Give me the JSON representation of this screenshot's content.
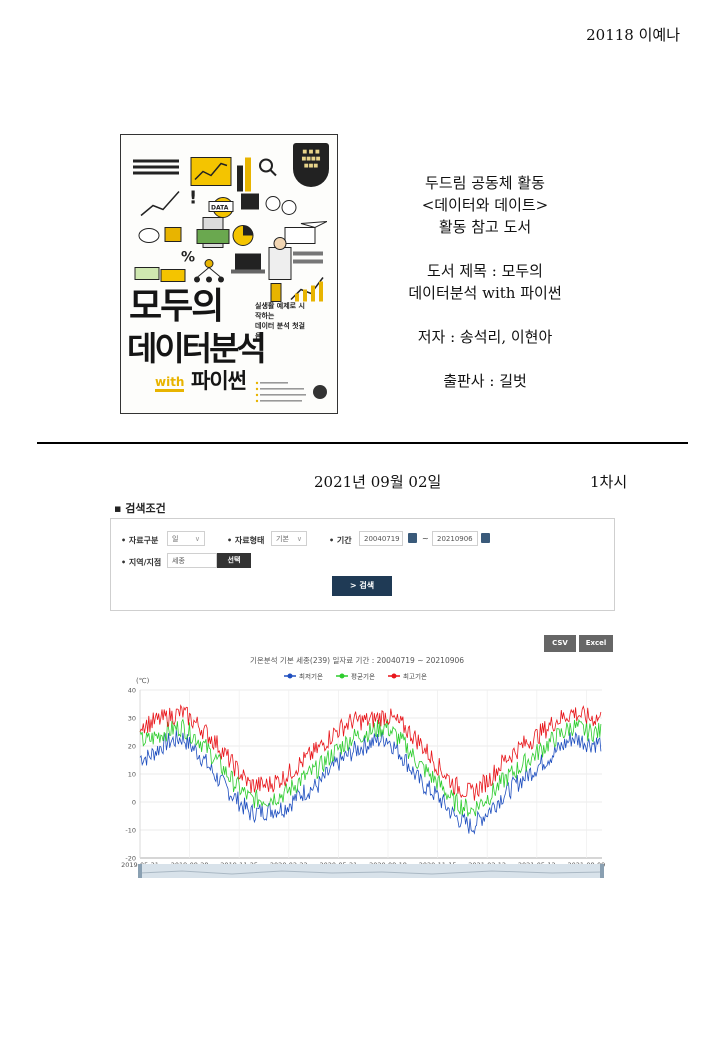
{
  "header": {
    "student": "20118 이예나"
  },
  "book_cover": {
    "title_line1": "모두의",
    "title_line2": "데이터분석",
    "with": "with",
    "python": "파이썬",
    "subtitle_line1": "실생활 예제로 시작하는",
    "subtitle_line2": "데이터 분석 첫걸음",
    "data_badge": "DATA"
  },
  "description": {
    "activity_line1": "두드림 공동체 활동",
    "activity_line2": "<데이터와 데이트>",
    "activity_line3": "활동 참고 도서",
    "book_title_line1": "도서 제목 : 모두의",
    "book_title_line2": "데이터분석 with 파이썬",
    "authors": "저자 : 송석리, 이현아",
    "publisher": "출판사 : 길벗"
  },
  "session": {
    "date": "2021년 09월 02일",
    "round": "1차시"
  },
  "search": {
    "section_title": "▪ 검색조건",
    "data_type_label": "• 자료구분",
    "data_type_value": "일",
    "data_form_label": "• 자료형태",
    "data_form_value": "기본",
    "period_label": "• 기간",
    "start_date": "20040719",
    "tilde": "~",
    "end_date": "20210906",
    "region_label": "• 지역/지점",
    "region_value": "세종",
    "select_button": "선택",
    "search_button": "> 검색"
  },
  "export": {
    "csv": "CSV",
    "excel": "Excel"
  },
  "chart_data": {
    "type": "line",
    "title": "기온분석 기본 세종(239) 일자료 기간 : 20040719 ~ 20210906",
    "ylabel": "(℃)",
    "ylim": [
      -20,
      40
    ],
    "yticks": [
      "40",
      "30",
      "20",
      "10",
      "0",
      "-10",
      "-20"
    ],
    "x_tick_labels": [
      "2019-05-31",
      "2019-08-28",
      "2019-11-25",
      "2020-02-22",
      "2020-05-21",
      "2020-08-18",
      "2020-11-15",
      "2021-02-12",
      "2021-05-12",
      "2021-08-09"
    ],
    "x_range": [
      "2019-05-31",
      "2021-09-06"
    ],
    "grid": true,
    "legend_position": "top-center",
    "series": [
      {
        "name": "최저기온",
        "color": "#1f4fbf",
        "monthly_x": [
          "2019-06",
          "2019-07",
          "2019-08",
          "2019-09",
          "2019-10",
          "2019-11",
          "2019-12",
          "2020-01",
          "2020-02",
          "2020-03",
          "2020-04",
          "2020-05",
          "2020-06",
          "2020-07",
          "2020-08",
          "2020-09",
          "2020-10",
          "2020-11",
          "2020-12",
          "2021-01",
          "2021-02",
          "2021-03",
          "2021-04",
          "2021-05",
          "2021-06",
          "2021-07",
          "2021-08"
        ],
        "values": [
          16,
          21,
          23,
          17,
          9,
          2,
          -4,
          -3,
          -2,
          3,
          6,
          13,
          18,
          21,
          23,
          16,
          7,
          2,
          -5,
          -9,
          -3,
          3,
          8,
          13,
          18,
          23,
          21
        ]
      },
      {
        "name": "평균기온",
        "color": "#2ecc2e",
        "monthly_x": [
          "2019-06",
          "2019-07",
          "2019-08",
          "2019-09",
          "2019-10",
          "2019-11",
          "2019-12",
          "2020-01",
          "2020-02",
          "2020-03",
          "2020-04",
          "2020-05",
          "2020-06",
          "2020-07",
          "2020-08",
          "2020-09",
          "2020-10",
          "2020-11",
          "2020-12",
          "2021-01",
          "2021-02",
          "2021-03",
          "2021-04",
          "2021-05",
          "2021-06",
          "2021-07",
          "2021-08"
        ],
        "values": [
          22,
          25,
          27,
          22,
          15,
          7,
          1,
          1,
          3,
          8,
          12,
          18,
          23,
          25,
          27,
          21,
          13,
          7,
          0,
          -3,
          2,
          8,
          13,
          18,
          23,
          27,
          25
        ]
      },
      {
        "name": "최고기온",
        "color": "#e8161b",
        "monthly_x": [
          "2019-06",
          "2019-07",
          "2019-08",
          "2019-09",
          "2019-10",
          "2019-11",
          "2019-12",
          "2020-01",
          "2020-02",
          "2020-03",
          "2020-04",
          "2020-05",
          "2020-06",
          "2020-07",
          "2020-08",
          "2020-09",
          "2020-10",
          "2020-11",
          "2020-12",
          "2021-01",
          "2021-02",
          "2021-03",
          "2021-04",
          "2021-05",
          "2021-06",
          "2021-07",
          "2021-08"
        ],
        "values": [
          28,
          30,
          32,
          27,
          21,
          13,
          6,
          6,
          9,
          14,
          19,
          25,
          29,
          29,
          31,
          27,
          21,
          13,
          6,
          3,
          8,
          15,
          20,
          24,
          29,
          32,
          30
        ]
      }
    ]
  }
}
